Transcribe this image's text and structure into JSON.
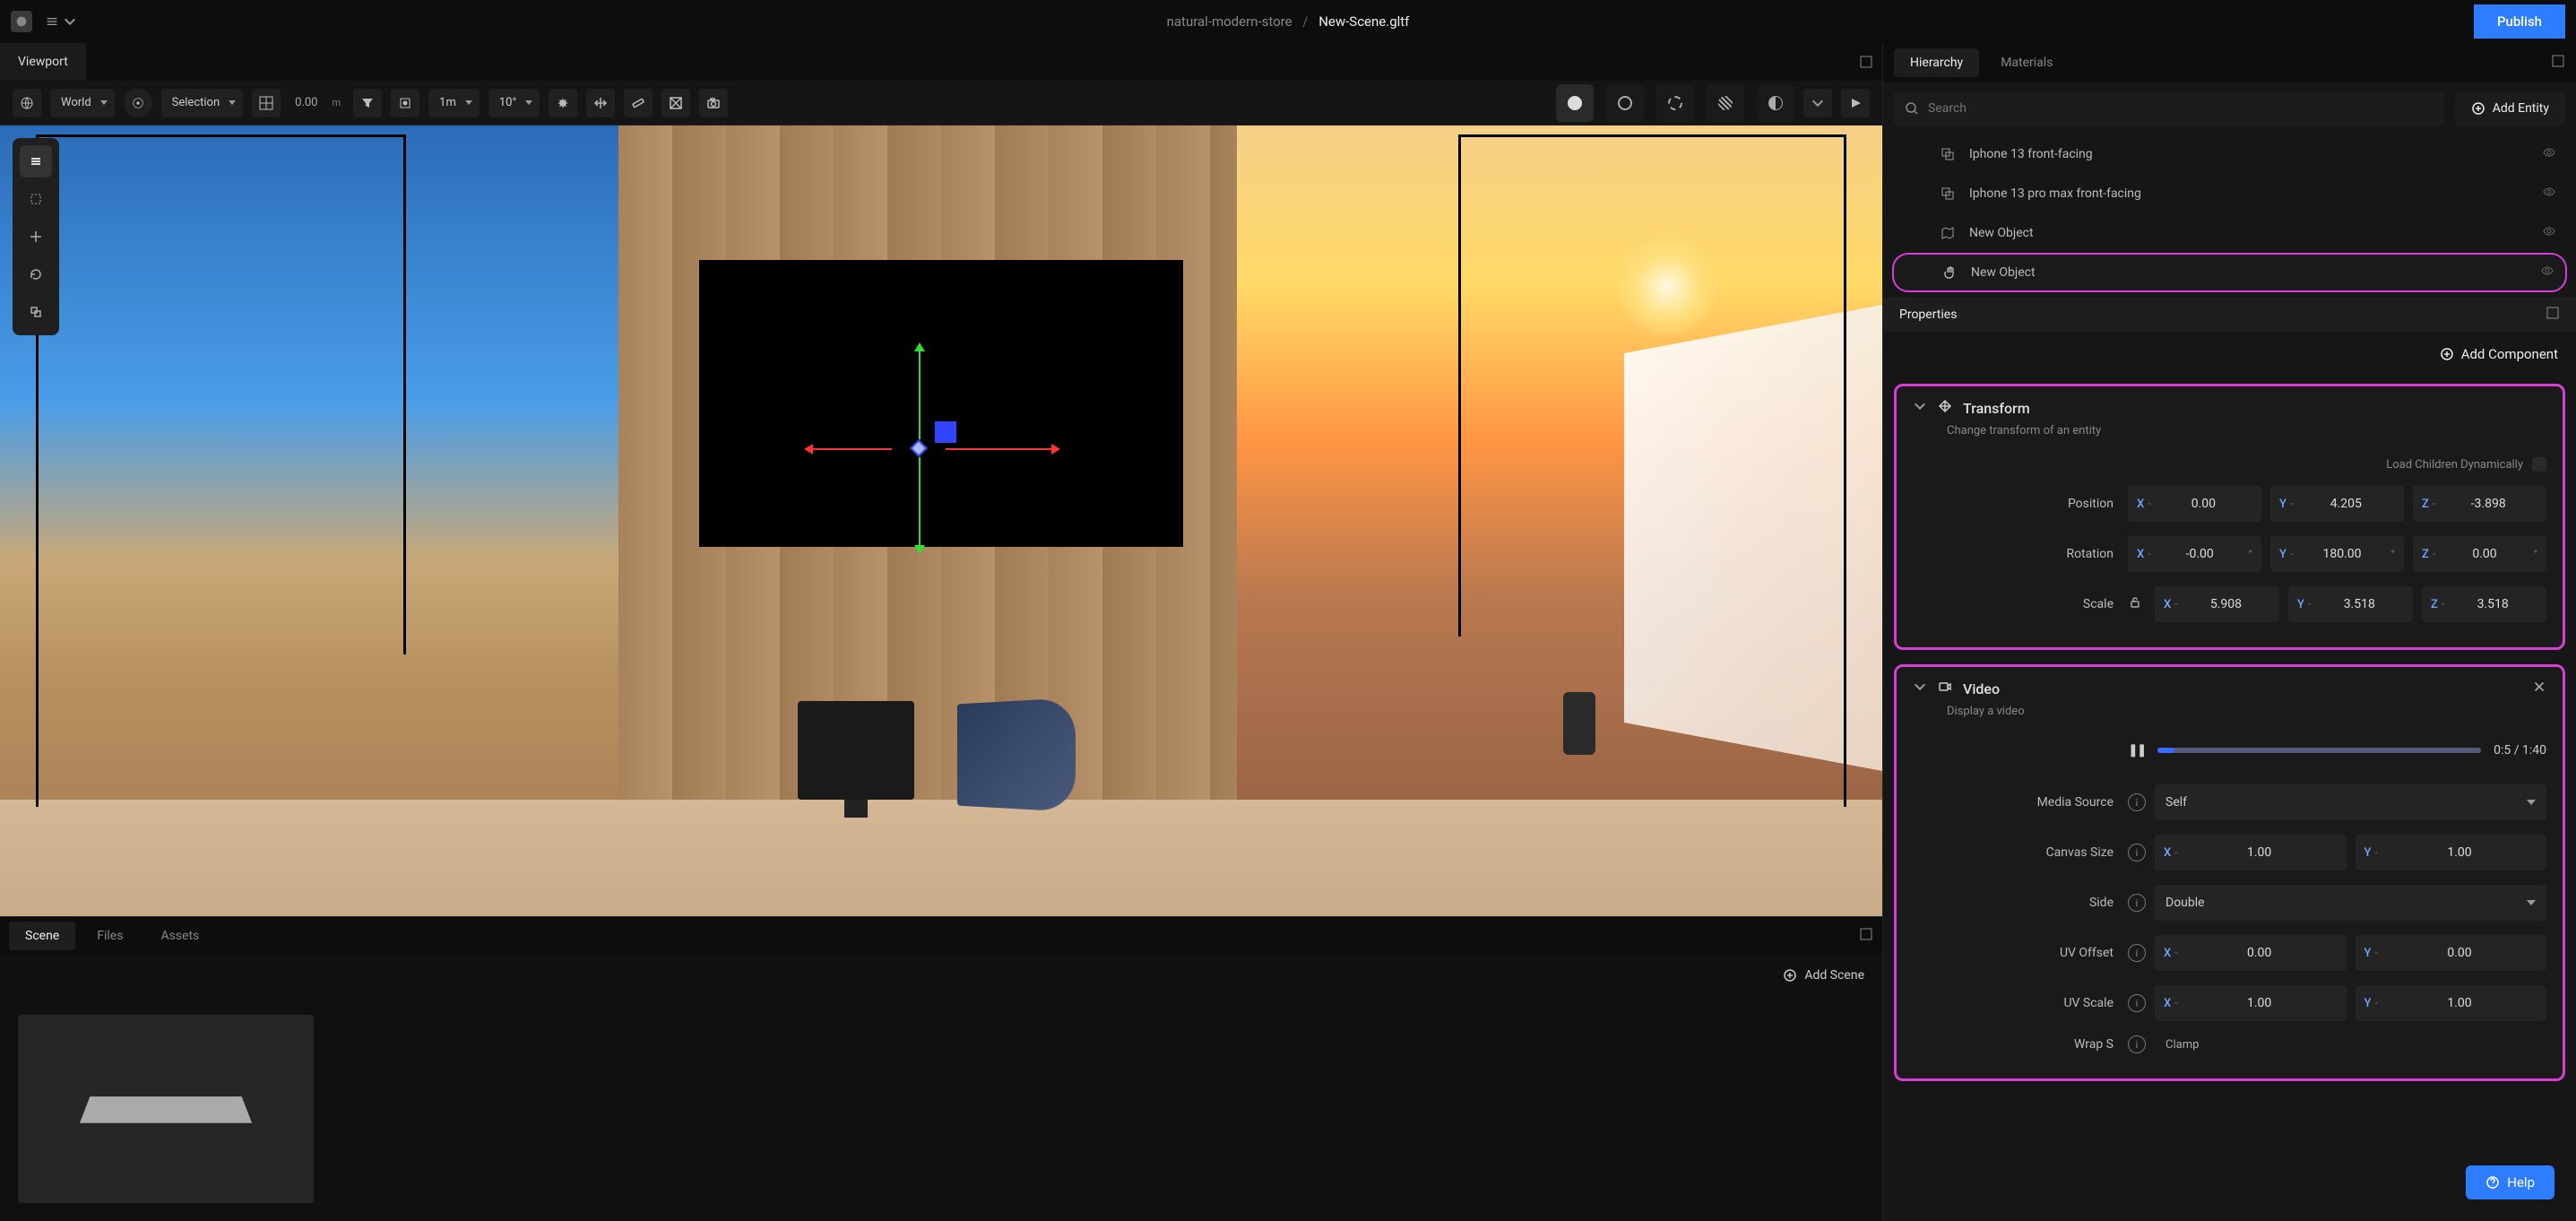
{
  "titlebar": {
    "project": "natural-modern-store",
    "file": "New-Scene.gltf",
    "publish": "Publish"
  },
  "viewport": {
    "tab": "Viewport",
    "coord_space": "World",
    "selection_mode": "Selection",
    "grid_value": "0.00",
    "grid_unit": "m",
    "snap_dist": "1m",
    "snap_angle": "10°"
  },
  "bottom": {
    "tabs": [
      "Scene",
      "Files",
      "Assets"
    ],
    "add_scene": "Add Scene"
  },
  "right": {
    "tabs": [
      "Hierarchy",
      "Materials"
    ],
    "search_placeholder": "Search",
    "add_entity": "Add Entity"
  },
  "hierarchy": [
    {
      "label": "Iphone 13 front-facing",
      "type": "mesh"
    },
    {
      "label": "Iphone 13 pro max front-facing",
      "type": "mesh"
    },
    {
      "label": "New Object",
      "type": "map"
    },
    {
      "label": "New Object",
      "type": "hand",
      "selected": true
    }
  ],
  "properties": {
    "header": "Properties",
    "add_component": "Add Component"
  },
  "transform": {
    "title": "Transform",
    "desc": "Change transform of an entity",
    "load_children": "Load Children Dynamically",
    "position_label": "Position",
    "position": {
      "x": "0.00",
      "y": "4.205",
      "z": "-3.898"
    },
    "rotation_label": "Rotation",
    "rotation": {
      "x": "-0.00",
      "y": "180.00",
      "z": "0.00"
    },
    "scale_label": "Scale",
    "scale": {
      "x": "5.908",
      "y": "3.518",
      "z": "3.518"
    }
  },
  "video": {
    "title": "Video",
    "desc": "Display a video",
    "time": "0:5 / 1:40",
    "media_source_label": "Media Source",
    "media_source": "Self",
    "canvas_size_label": "Canvas Size",
    "canvas_size": {
      "x": "1.00",
      "y": "1.00"
    },
    "side_label": "Side",
    "side": "Double",
    "uv_offset_label": "UV Offset",
    "uv_offset": {
      "x": "0.00",
      "y": "0.00"
    },
    "uv_scale_label": "UV Scale",
    "uv_scale": {
      "x": "1.00",
      "y": "1.00"
    },
    "wrap_s_label": "Wrap S",
    "wrap_s": "Clamp"
  },
  "help": "Help"
}
